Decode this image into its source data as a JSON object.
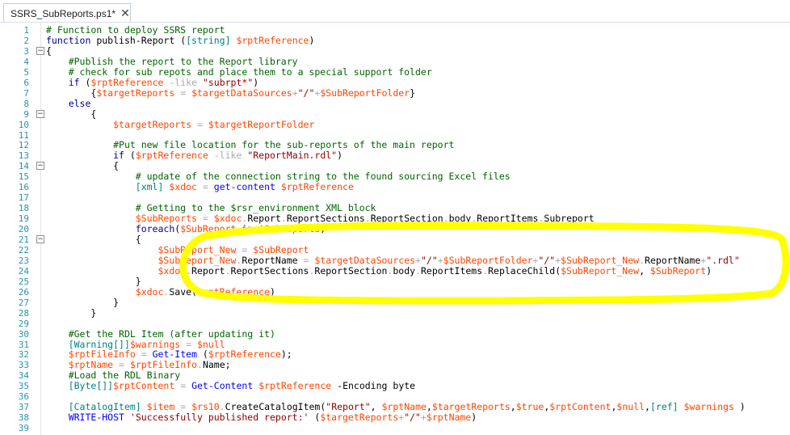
{
  "tab": {
    "title": "SSRS_SubReports.ps1*",
    "close_glyph": "✕"
  },
  "colors": {
    "comment": "#006400",
    "keyword": "#00008b",
    "variable": "#ff4500",
    "string": "#8b0000",
    "type": "#008080",
    "operator": "#a9a9a9",
    "command": "#0000ff",
    "line_number": "#2b91af",
    "highlight": "#ffff00"
  },
  "lines": [
    {
      "n": "1",
      "fold": "",
      "t": [
        [
          "c",
          "# Function to deploy SSRS report"
        ]
      ]
    },
    {
      "n": "2",
      "fold": "",
      "t": [
        [
          "k",
          "function"
        ],
        [
          "p",
          " "
        ],
        [
          "p",
          "publish-Report"
        ],
        [
          "p",
          " ("
        ],
        [
          "y",
          "[string]"
        ],
        [
          "p",
          " "
        ],
        [
          "v",
          "$rptReference"
        ],
        [
          "p",
          ")"
        ]
      ]
    },
    {
      "n": "3",
      "fold": "minus",
      "t": [
        [
          "p",
          "{"
        ]
      ]
    },
    {
      "n": "4",
      "fold": "",
      "t": [
        [
          "p",
          "    "
        ],
        [
          "c",
          "#Publish the report to the Report library"
        ]
      ]
    },
    {
      "n": "5",
      "fold": "",
      "t": [
        [
          "p",
          "    "
        ],
        [
          "c",
          "# check for sub repots and place them to a special support folder"
        ]
      ]
    },
    {
      "n": "6",
      "fold": "",
      "t": [
        [
          "p",
          "    "
        ],
        [
          "k",
          "if"
        ],
        [
          "p",
          " ("
        ],
        [
          "v",
          "$rptReference"
        ],
        [
          "p",
          " "
        ],
        [
          "o",
          "-like"
        ],
        [
          "p",
          " "
        ],
        [
          "s",
          "\"subrpt*\""
        ],
        [
          "p",
          ")"
        ]
      ]
    },
    {
      "n": "7",
      "fold": "",
      "t": [
        [
          "p",
          "        {"
        ],
        [
          "v",
          "$targetReports"
        ],
        [
          "p",
          " "
        ],
        [
          "o",
          "="
        ],
        [
          "p",
          " "
        ],
        [
          "v",
          "$targetDataSources"
        ],
        [
          "o",
          "+"
        ],
        [
          "s",
          "\"/\""
        ],
        [
          "o",
          "+"
        ],
        [
          "v",
          "$SubReportFolder"
        ],
        [
          "p",
          "}"
        ]
      ]
    },
    {
      "n": "8",
      "fold": "",
      "t": [
        [
          "p",
          "    "
        ],
        [
          "k",
          "else"
        ]
      ]
    },
    {
      "n": "9",
      "fold": "minus",
      "t": [
        [
          "p",
          "        {"
        ]
      ]
    },
    {
      "n": "10",
      "fold": "",
      "t": [
        [
          "p",
          "            "
        ],
        [
          "v",
          "$targetReports"
        ],
        [
          "p",
          " "
        ],
        [
          "o",
          "="
        ],
        [
          "p",
          " "
        ],
        [
          "v",
          "$targetReportFolder"
        ]
      ]
    },
    {
      "n": "11",
      "fold": "",
      "t": []
    },
    {
      "n": "12",
      "fold": "",
      "t": [
        [
          "p",
          "            "
        ],
        [
          "c",
          "#Put new file location for the sub-reports of the main report"
        ]
      ]
    },
    {
      "n": "13",
      "fold": "",
      "t": [
        [
          "p",
          "            "
        ],
        [
          "k",
          "if"
        ],
        [
          "p",
          " ("
        ],
        [
          "v",
          "$rptReference"
        ],
        [
          "p",
          " "
        ],
        [
          "o",
          "-like"
        ],
        [
          "p",
          " "
        ],
        [
          "s",
          "\"ReportMain.rdl\""
        ],
        [
          "p",
          ")"
        ]
      ]
    },
    {
      "n": "14",
      "fold": "minus",
      "t": [
        [
          "p",
          "            {"
        ]
      ]
    },
    {
      "n": "15",
      "fold": "",
      "t": [
        [
          "p",
          "                "
        ],
        [
          "c",
          "# update of the connection string to the found sourcing Excel files"
        ]
      ]
    },
    {
      "n": "16",
      "fold": "",
      "t": [
        [
          "p",
          "                "
        ],
        [
          "y",
          "[xml]"
        ],
        [
          "p",
          " "
        ],
        [
          "v",
          "$xdoc"
        ],
        [
          "p",
          " "
        ],
        [
          "o",
          "="
        ],
        [
          "p",
          " "
        ],
        [
          "m",
          "get-content"
        ],
        [
          "p",
          " "
        ],
        [
          "v",
          "$rptReference"
        ]
      ]
    },
    {
      "n": "17",
      "fold": "",
      "t": []
    },
    {
      "n": "18",
      "fold": "",
      "t": [
        [
          "p",
          "                "
        ],
        [
          "c",
          "# Getting to the $rsr_environment XML block"
        ]
      ]
    },
    {
      "n": "19",
      "fold": "",
      "t": [
        [
          "p",
          "                "
        ],
        [
          "v",
          "$SubReports"
        ],
        [
          "p",
          " "
        ],
        [
          "o",
          "="
        ],
        [
          "p",
          " "
        ],
        [
          "v",
          "$xdoc"
        ],
        [
          "o",
          "."
        ],
        [
          "p",
          "Report"
        ],
        [
          "o",
          "."
        ],
        [
          "p",
          "ReportSections"
        ],
        [
          "o",
          "."
        ],
        [
          "p",
          "ReportSection"
        ],
        [
          "o",
          "."
        ],
        [
          "p",
          "body"
        ],
        [
          "o",
          "."
        ],
        [
          "p",
          "ReportItems"
        ],
        [
          "o",
          "."
        ],
        [
          "p",
          "Subreport"
        ]
      ]
    },
    {
      "n": "20",
      "fold": "",
      "t": [
        [
          "p",
          "                "
        ],
        [
          "k",
          "foreach"
        ],
        [
          "p",
          "("
        ],
        [
          "v",
          "$SubReport"
        ],
        [
          "p",
          " "
        ],
        [
          "k",
          "in"
        ],
        [
          "p",
          " "
        ],
        [
          "v",
          "$SubReports"
        ],
        [
          "p",
          ")"
        ]
      ]
    },
    {
      "n": "21",
      "fold": "minus",
      "t": [
        [
          "p",
          "                {"
        ]
      ]
    },
    {
      "n": "22",
      "fold": "",
      "t": [
        [
          "p",
          "                    "
        ],
        [
          "v",
          "$SubReport_New"
        ],
        [
          "p",
          " "
        ],
        [
          "o",
          "="
        ],
        [
          "p",
          " "
        ],
        [
          "v",
          "$SubReport"
        ]
      ]
    },
    {
      "n": "23",
      "fold": "",
      "t": [
        [
          "p",
          "                    "
        ],
        [
          "v",
          "$SubReport_New"
        ],
        [
          "o",
          "."
        ],
        [
          "p",
          "ReportName"
        ],
        [
          "p",
          " "
        ],
        [
          "o",
          "="
        ],
        [
          "p",
          " "
        ],
        [
          "v",
          "$targetDataSources"
        ],
        [
          "o",
          "+"
        ],
        [
          "s",
          "\"/\""
        ],
        [
          "o",
          "+"
        ],
        [
          "v",
          "$SubReportFolder"
        ],
        [
          "o",
          "+"
        ],
        [
          "s",
          "\"/\""
        ],
        [
          "o",
          "+"
        ],
        [
          "v",
          "$SubReport_New"
        ],
        [
          "o",
          "."
        ],
        [
          "p",
          "ReportName"
        ],
        [
          "o",
          "+"
        ],
        [
          "s",
          "\".rdl\""
        ]
      ]
    },
    {
      "n": "24",
      "fold": "",
      "t": [
        [
          "p",
          "                    "
        ],
        [
          "v",
          "$xdoc"
        ],
        [
          "o",
          "."
        ],
        [
          "p",
          "Report"
        ],
        [
          "o",
          "."
        ],
        [
          "p",
          "ReportSections"
        ],
        [
          "o",
          "."
        ],
        [
          "p",
          "ReportSection"
        ],
        [
          "o",
          "."
        ],
        [
          "p",
          "body"
        ],
        [
          "o",
          "."
        ],
        [
          "p",
          "ReportItems"
        ],
        [
          "o",
          "."
        ],
        [
          "p",
          "ReplaceChild("
        ],
        [
          "v",
          "$SubReport_New"
        ],
        [
          "p",
          ", "
        ],
        [
          "v",
          "$SubReport"
        ],
        [
          "p",
          ")"
        ]
      ]
    },
    {
      "n": "25",
      "fold": "",
      "t": [
        [
          "p",
          "                }"
        ]
      ]
    },
    {
      "n": "26",
      "fold": "",
      "t": [
        [
          "p",
          "                "
        ],
        [
          "v",
          "$xdoc"
        ],
        [
          "o",
          "."
        ],
        [
          "p",
          "Save("
        ],
        [
          "v",
          "$rptReference"
        ],
        [
          "p",
          ")"
        ]
      ]
    },
    {
      "n": "27",
      "fold": "",
      "t": [
        [
          "p",
          "            }"
        ]
      ]
    },
    {
      "n": "28",
      "fold": "",
      "t": [
        [
          "p",
          "        }"
        ]
      ]
    },
    {
      "n": "29",
      "fold": "",
      "t": []
    },
    {
      "n": "30",
      "fold": "",
      "t": [
        [
          "p",
          "    "
        ],
        [
          "c",
          "#Get the RDL Item (after updating it)"
        ]
      ]
    },
    {
      "n": "31",
      "fold": "",
      "t": [
        [
          "p",
          "    "
        ],
        [
          "y",
          "[Warning[]]"
        ],
        [
          "v",
          "$warnings"
        ],
        [
          "p",
          " "
        ],
        [
          "o",
          "="
        ],
        [
          "p",
          " "
        ],
        [
          "v",
          "$null"
        ]
      ]
    },
    {
      "n": "32",
      "fold": "",
      "t": [
        [
          "p",
          "    "
        ],
        [
          "v",
          "$rptFileInfo"
        ],
        [
          "p",
          " "
        ],
        [
          "o",
          "="
        ],
        [
          "p",
          " "
        ],
        [
          "m",
          "Get-Item"
        ],
        [
          "p",
          " ("
        ],
        [
          "v",
          "$rptReference"
        ],
        [
          "p",
          ");"
        ]
      ]
    },
    {
      "n": "33",
      "fold": "",
      "t": [
        [
          "p",
          "    "
        ],
        [
          "v",
          "$rptName"
        ],
        [
          "p",
          " "
        ],
        [
          "o",
          "="
        ],
        [
          "p",
          " "
        ],
        [
          "v",
          "$rptFileInfo"
        ],
        [
          "o",
          "."
        ],
        [
          "p",
          "Name;"
        ]
      ]
    },
    {
      "n": "34",
      "fold": "",
      "t": [
        [
          "p",
          "    "
        ],
        [
          "c",
          "#Load the RDL Binary"
        ]
      ]
    },
    {
      "n": "35",
      "fold": "",
      "t": [
        [
          "p",
          "    "
        ],
        [
          "y",
          "[Byte[]]"
        ],
        [
          "v",
          "$rptContent"
        ],
        [
          "p",
          " "
        ],
        [
          "o",
          "="
        ],
        [
          "p",
          " "
        ],
        [
          "m",
          "Get-Content"
        ],
        [
          "p",
          " "
        ],
        [
          "v",
          "$rptReference"
        ],
        [
          "p",
          " "
        ],
        [
          "p",
          "-Encoding"
        ],
        [
          "p",
          " "
        ],
        [
          "p",
          "byte"
        ]
      ]
    },
    {
      "n": "36",
      "fold": "",
      "t": []
    },
    {
      "n": "37",
      "fold": "",
      "t": [
        [
          "p",
          "    "
        ],
        [
          "y",
          "[CatalogItem]"
        ],
        [
          "p",
          " "
        ],
        [
          "v",
          "$item"
        ],
        [
          "p",
          " "
        ],
        [
          "o",
          "="
        ],
        [
          "p",
          " "
        ],
        [
          "v",
          "$rs10"
        ],
        [
          "o",
          "."
        ],
        [
          "p",
          "CreateCatalogItem("
        ],
        [
          "s",
          "\"Report\""
        ],
        [
          "p",
          ", "
        ],
        [
          "v",
          "$rptName"
        ],
        [
          "p",
          ","
        ],
        [
          "v",
          "$targetReports"
        ],
        [
          "p",
          ","
        ],
        [
          "v",
          "$true"
        ],
        [
          "p",
          ","
        ],
        [
          "v",
          "$rptContent"
        ],
        [
          "p",
          ","
        ],
        [
          "v",
          "$null"
        ],
        [
          "p",
          ","
        ],
        [
          "y",
          "[ref]"
        ],
        [
          "p",
          " "
        ],
        [
          "v",
          "$warnings"
        ],
        [
          "p",
          " )"
        ]
      ]
    },
    {
      "n": "38",
      "fold": "",
      "t": [
        [
          "p",
          "    "
        ],
        [
          "m",
          "WRITE-HOST"
        ],
        [
          "p",
          " "
        ],
        [
          "s",
          "'Successfully published report:'"
        ],
        [
          "p",
          " ("
        ],
        [
          "v",
          "$targetReports"
        ],
        [
          "o",
          "+"
        ],
        [
          "s",
          "\"/\""
        ],
        [
          "o",
          "+"
        ],
        [
          "v",
          "$rptName"
        ],
        [
          "p",
          ")"
        ]
      ]
    },
    {
      "n": "39",
      "fold": "",
      "t": []
    }
  ]
}
